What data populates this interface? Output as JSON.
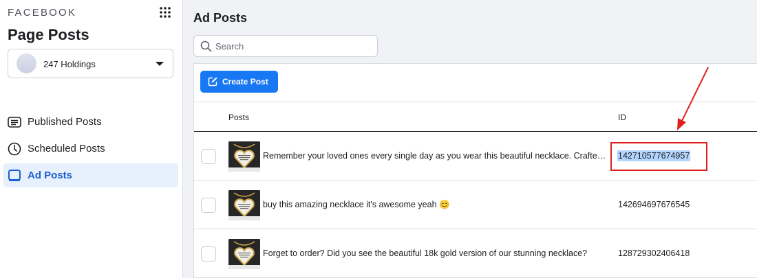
{
  "sidebar": {
    "brand": "FACEBOOK",
    "title": "Page Posts",
    "account": {
      "name": "247 Holdings",
      "icon": "avatar"
    },
    "nav": [
      {
        "label": "Published Posts",
        "icon": "list-icon",
        "active": false
      },
      {
        "label": "Scheduled Posts",
        "icon": "clock-icon",
        "active": false
      },
      {
        "label": "Ad Posts",
        "icon": "ad-posts-icon",
        "active": true
      }
    ]
  },
  "main": {
    "title": "Ad Posts",
    "search": {
      "placeholder": "Search",
      "value": ""
    },
    "create_label": "Create Post",
    "columns": {
      "posts": "Posts",
      "id": "ID"
    },
    "rows": [
      {
        "text": "Remember your loved ones every single day as you wear this beautiful necklace. Crafted with love",
        "id": "142710577674957",
        "highlighted": true
      },
      {
        "text": "buy this amazing necklace it's awesome yeah 😊",
        "id": "142694697676545",
        "highlighted": false
      },
      {
        "text": "Forget to order? Did you see the beautiful 18k gold version of our stunning necklace?",
        "id": "128729302406418",
        "highlighted": false
      }
    ]
  },
  "colors": {
    "accent": "#1877f2",
    "active_nav_bg": "#e7f0fd",
    "annotation": "#e0201d",
    "selection": "#b4d5fe"
  }
}
